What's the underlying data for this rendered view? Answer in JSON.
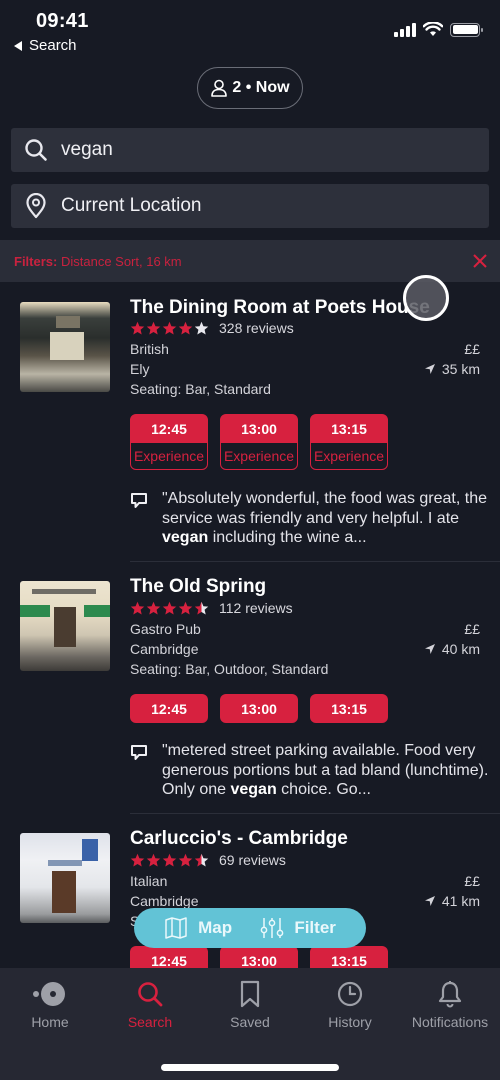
{
  "status_bar": {
    "time": "09:41",
    "back_label": "Search",
    "icons": [
      "signal-icon",
      "wifi-icon",
      "battery-icon"
    ]
  },
  "party": {
    "label": "2 • Now",
    "icon": "person-icon"
  },
  "search": {
    "query": "vegan",
    "icon": "search-icon",
    "location": "Current Location",
    "location_icon": "location-pin-icon"
  },
  "filters": {
    "label": "Filters:",
    "value": "Distance Sort, 16 km",
    "clear_icon": "close-icon"
  },
  "colors": {
    "accent": "#d7213f",
    "background": "#171a24",
    "field": "#2d303b",
    "pill": "#62c3d6"
  },
  "restaurants": [
    {
      "name": "The Dining Room at Poets House",
      "rating": 4,
      "reviews": "328 reviews",
      "cuisine": "British",
      "price": "££",
      "area": "Ely",
      "distance": "35 km",
      "seating": "Seating: Bar, Standard",
      "slots": [
        {
          "time": "12:45",
          "tag": "Experience"
        },
        {
          "time": "13:00",
          "tag": "Experience"
        },
        {
          "time": "13:15",
          "tag": "Experience"
        }
      ],
      "review_pre": "\"Absolutely wonderful, the food was great, the service was friendly and very helpful. I ate ",
      "review_bold": "vegan",
      "review_post": " including the wine a..."
    },
    {
      "name": "The Old Spring",
      "rating": 4.5,
      "reviews": "112 reviews",
      "cuisine": "Gastro Pub",
      "price": "££",
      "area": "Cambridge",
      "distance": "40 km",
      "seating": "Seating: Bar, Outdoor, Standard",
      "slots": [
        {
          "time": "12:45"
        },
        {
          "time": "13:00"
        },
        {
          "time": "13:15"
        }
      ],
      "review_pre": "\"metered street parking available. Food very generous portions but a tad bland (lunchtime). Only one ",
      "review_bold": "vegan",
      "review_post": " choice. Go..."
    },
    {
      "name": "Carluccio's - Cambridge",
      "rating": 4.5,
      "reviews": "69 reviews",
      "cuisine": "Italian",
      "price": "££",
      "area": "Cambridge",
      "distance": "41 km",
      "seating": "S",
      "slots": [
        {
          "time": "12:45"
        },
        {
          "time": "13:00"
        },
        {
          "time": "13:15"
        }
      ]
    }
  ],
  "floating_actions": {
    "map_label": "Map",
    "filter_label": "Filter"
  },
  "tab_bar": {
    "items": [
      {
        "label": "Home",
        "icon": "home-icon",
        "active": false
      },
      {
        "label": "Search",
        "icon": "search-icon",
        "active": true
      },
      {
        "label": "Saved",
        "icon": "bookmark-icon",
        "active": false
      },
      {
        "label": "History",
        "icon": "clock-icon",
        "active": false
      },
      {
        "label": "Notifications",
        "icon": "bell-icon",
        "active": false
      }
    ]
  }
}
